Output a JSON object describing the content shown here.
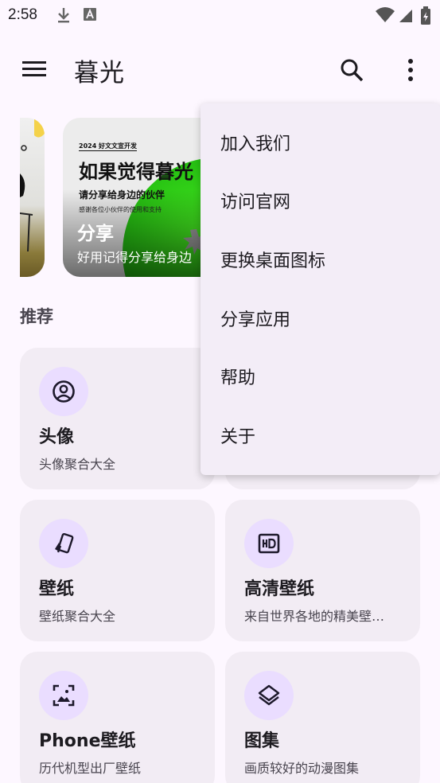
{
  "status_bar": {
    "time": "2:58"
  },
  "app_bar": {
    "title": "暮光"
  },
  "banners": {
    "main": {
      "year_tag": "2024 好文文宣开发",
      "heading": "如果觉得暮光",
      "sub1": "请分享给身边的伙伴",
      "sub2": "感谢各位小伙伴的使用和支持",
      "title": "分享",
      "text": "好用记得分享给身边"
    }
  },
  "section": {
    "title": "推荐"
  },
  "cards": [
    {
      "title": "头像",
      "desc": "头像聚合大全",
      "icon": "account-circle-icon"
    },
    {
      "title": "壁纸",
      "desc": "壁纸聚合大全",
      "icon": "wallpaper-icon"
    },
    {
      "title": "高清壁纸",
      "desc": "来自世界各地的精美壁…",
      "icon": "hd-icon"
    },
    {
      "title": "Phone壁纸",
      "desc": "历代机型出厂壁纸",
      "icon": "phone-image-icon"
    },
    {
      "title": "图集",
      "desc": "画质较好的动漫图集",
      "icon": "layers-icon"
    }
  ],
  "menu": {
    "items": [
      "加入我们",
      "访问官网",
      "更换桌面图标",
      "分享应用",
      "帮助",
      "关于"
    ]
  },
  "colors": {
    "accent": "#1d192b",
    "icon_bg": "#eaddff",
    "card_bg": "#f2ecf4",
    "page_bg": "#fdf7ff"
  }
}
